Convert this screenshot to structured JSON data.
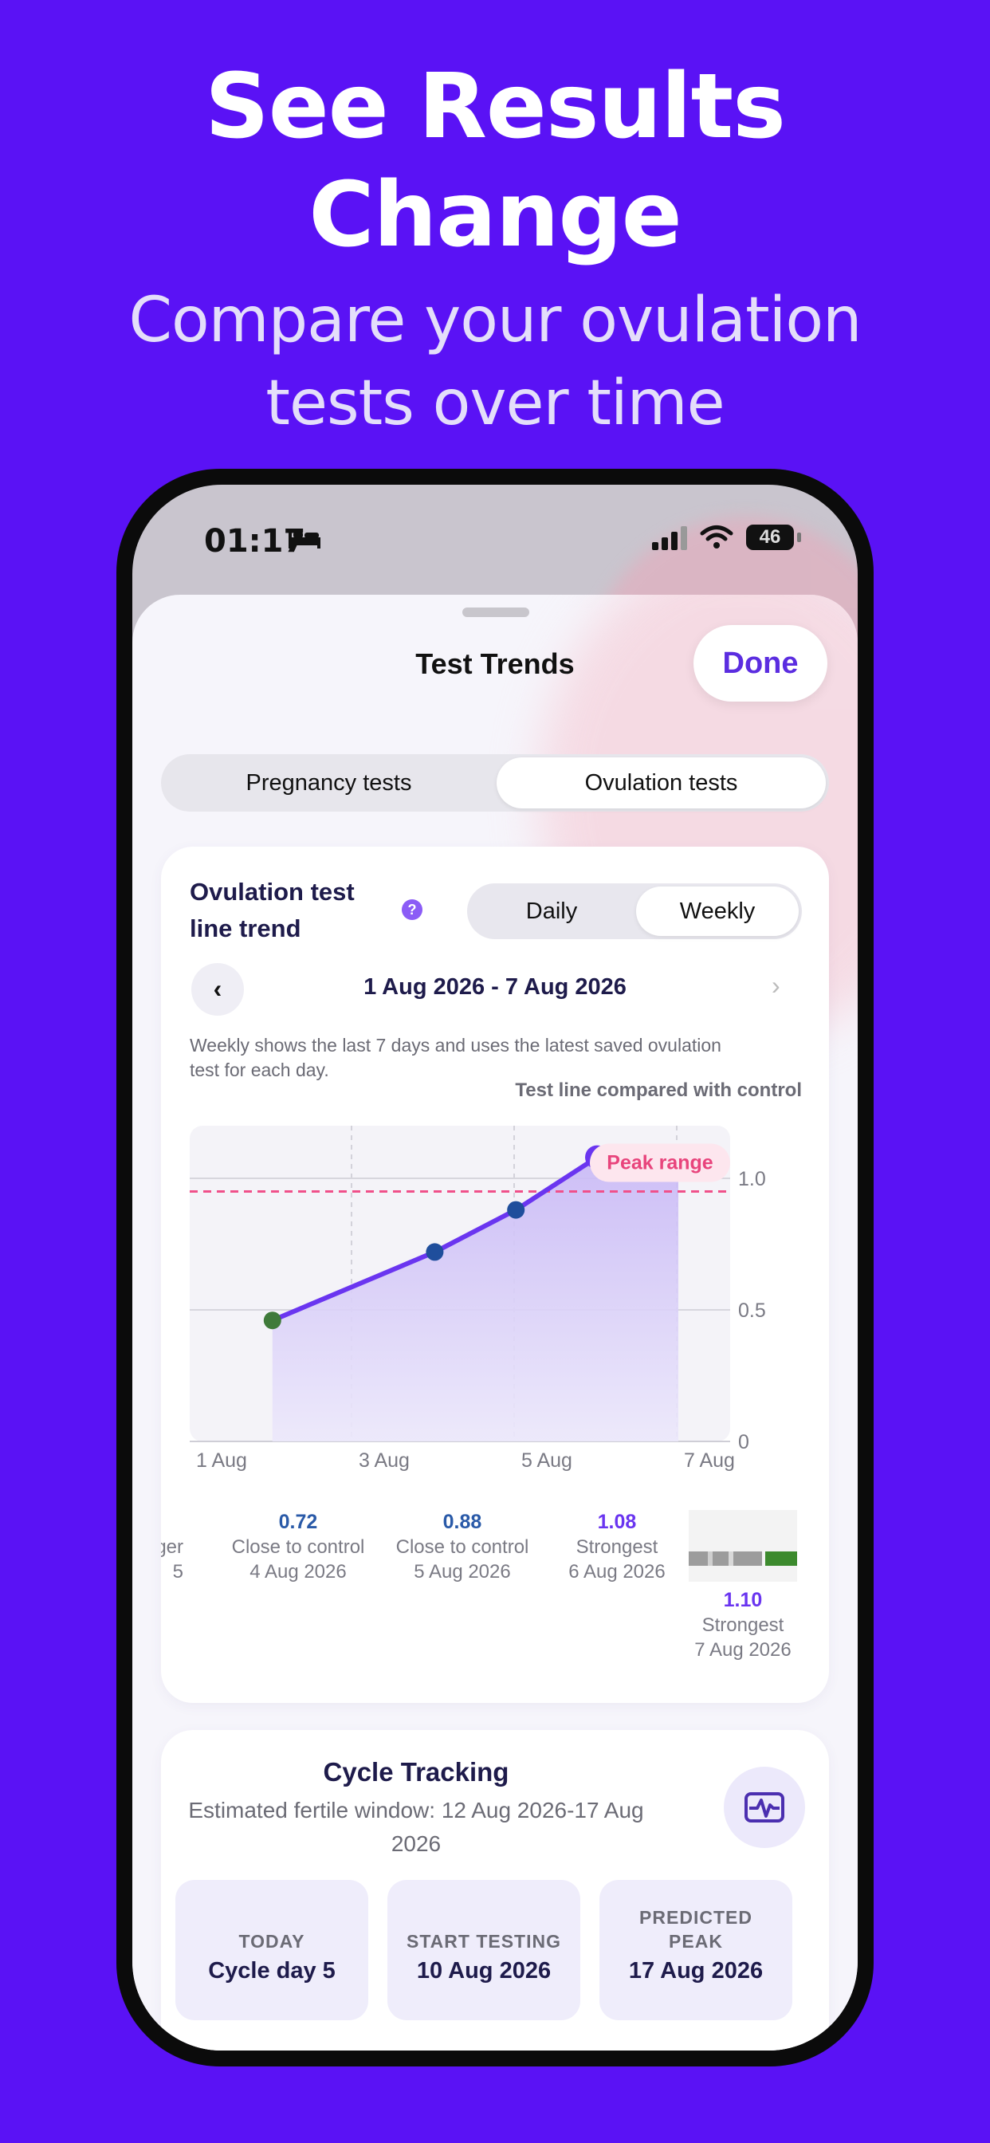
{
  "promo": {
    "headline_1": "See Results",
    "headline_2": "Change",
    "sub_1": "Compare your ovulation",
    "sub_2": "tests over time"
  },
  "status_bar": {
    "time": "01:17",
    "battery": "46"
  },
  "sheet": {
    "title": "Test Trends",
    "done_label": "Done"
  },
  "tabs": [
    {
      "label": "Pregnancy tests",
      "selected": false
    },
    {
      "label": "Ovulation tests",
      "selected": true
    }
  ],
  "trend_card": {
    "title": "Ovulation test line trend",
    "help_icon": "?",
    "period_toggle": [
      {
        "label": "Daily",
        "selected": false
      },
      {
        "label": "Weekly",
        "selected": true
      }
    ],
    "prev_icon": "‹",
    "next_icon": "›",
    "date_range": "1 Aug 2026 - 7 Aug 2026",
    "description": "Weekly shows the last 7 days and uses the latest saved ovulation test for each day.",
    "comparison_label": "Test line compared with control"
  },
  "chart_data": {
    "type": "line",
    "x": [
      "2 Aug",
      "4 Aug",
      "5 Aug",
      "6 Aug",
      "7 Aug"
    ],
    "x_tick_labels": [
      "1 Aug",
      "3 Aug",
      "5 Aug",
      "7 Aug"
    ],
    "y_tick_labels": [
      "0",
      "0.5",
      "1.0"
    ],
    "series": [
      {
        "values": [
          0.46,
          0.72,
          0.88,
          1.08,
          1.1
        ],
        "point_colors": [
          "#3f7a3a",
          "#1f4e9c",
          "#1f4e9c",
          "#6a35f0",
          "#6a35f0"
        ]
      }
    ],
    "reference_line": {
      "value": 0.95,
      "label": "Peak range",
      "color": "#f0508a"
    },
    "ylim": [
      0,
      1.2
    ],
    "grid": true,
    "line_color": "#6a35f0"
  },
  "test_points": [
    {
      "value": "",
      "status": "ger",
      "date": "5",
      "cut": true
    },
    {
      "value": "0.72",
      "status": "Close to control",
      "date": "4 Aug 2026",
      "color": "#2a5aa8"
    },
    {
      "value": "0.88",
      "status": "Close to control",
      "date": "5 Aug 2026",
      "color": "#2a5aa8"
    },
    {
      "value": "1.08",
      "status": "Strongest",
      "date": "6 Aug 2026",
      "color": "#6a35f0"
    },
    {
      "value": "1.10",
      "status": "Strongest",
      "date": "7 Aug 2026",
      "color": "#6a35f0"
    }
  ],
  "cycle": {
    "title": "Cycle Tracking",
    "subtitle": "Estimated fertile window: 12 Aug 2026-17 Aug 2026",
    "tiles": [
      {
        "label": "TODAY",
        "value": "Cycle day 5"
      },
      {
        "label": "START TESTING",
        "value": "10 Aug 2026"
      },
      {
        "label": "PREDICTED PEAK",
        "value": "17 Aug 2026"
      }
    ]
  }
}
